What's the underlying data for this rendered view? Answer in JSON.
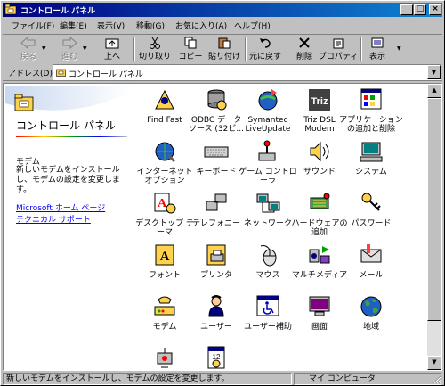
{
  "window": {
    "title": "コントロール パネル",
    "buttons": {
      "minimize": "_",
      "maximize": "□",
      "close": "×"
    }
  },
  "menu": [
    "ファイル(F)",
    "編集(E)",
    "表示(V)",
    "移動(G)",
    "お気に入り(A)",
    "ヘルプ(H)"
  ],
  "toolbar": {
    "back": "戻る",
    "forward": "進む",
    "up": "上へ",
    "cut": "切り取り",
    "copy": "コピー",
    "paste": "貼り付け",
    "undo": "元に戻す",
    "delete": "削除",
    "properties": "プロパティ",
    "views": "表示"
  },
  "address": {
    "label": "アドレス(D)",
    "value": "コントロール パネル"
  },
  "webview": {
    "title": "コントロール パネル",
    "selected_name": "モデム",
    "selected_desc": "新しいモデムをインストールし、モデムの設定を変更します。",
    "links": [
      "Microsoft ホーム ページ",
      "テクニカル サポート"
    ]
  },
  "icons": [
    {
      "label": "Find Fast",
      "icon": "find-fast-icon"
    },
    {
      "label": "ODBC データ\nソース (32ビ...",
      "icon": "odbc-icon"
    },
    {
      "label": "Symantec\nLiveUpdate",
      "icon": "liveupdate-icon"
    },
    {
      "label": "Triz DSL\nModem",
      "icon": "triz-modem-icon"
    },
    {
      "label": "アプリケーション\nの追加と削除",
      "icon": "add-remove-programs-icon"
    },
    {
      "label": "インターネット\nオプション",
      "icon": "internet-options-icon"
    },
    {
      "label": "キーボード",
      "icon": "keyboard-icon"
    },
    {
      "label": "ゲーム コントロ\nーラ",
      "icon": "game-controller-icon"
    },
    {
      "label": "サウンド",
      "icon": "sound-icon"
    },
    {
      "label": "システム",
      "icon": "system-icon"
    },
    {
      "label": "デスクトップ テ\nーマ",
      "icon": "desktop-themes-icon"
    },
    {
      "label": "テレフォニー",
      "icon": "telephony-icon"
    },
    {
      "label": "ネットワーク",
      "icon": "network-icon"
    },
    {
      "label": "ハードウェアの\n追加",
      "icon": "add-hardware-icon"
    },
    {
      "label": "パスワード",
      "icon": "passwords-icon"
    },
    {
      "label": "フォント",
      "icon": "fonts-icon"
    },
    {
      "label": "プリンタ",
      "icon": "printers-icon"
    },
    {
      "label": "マウス",
      "icon": "mouse-icon"
    },
    {
      "label": "マルチメディア",
      "icon": "multimedia-icon"
    },
    {
      "label": "メール",
      "icon": "mail-icon"
    },
    {
      "label": "モデム",
      "icon": "modem-icon"
    },
    {
      "label": "ユーザー",
      "icon": "users-icon"
    },
    {
      "label": "ユーザー補助",
      "icon": "accessibility-icon"
    },
    {
      "label": "画面",
      "icon": "display-icon"
    },
    {
      "label": "地域",
      "icon": "regional-settings-icon"
    },
    {
      "label": "",
      "icon": "power-icon"
    },
    {
      "label": "",
      "icon": "date-time-icon"
    }
  ],
  "status": {
    "left": "新しいモデムをインストールし、モデムの設定を変更します。",
    "right": "マイ コンピュータ"
  },
  "colors": {
    "title_start": "#000080",
    "title_end": "#1084d0",
    "link": "#0000ff",
    "face": "#c0c0c0"
  }
}
